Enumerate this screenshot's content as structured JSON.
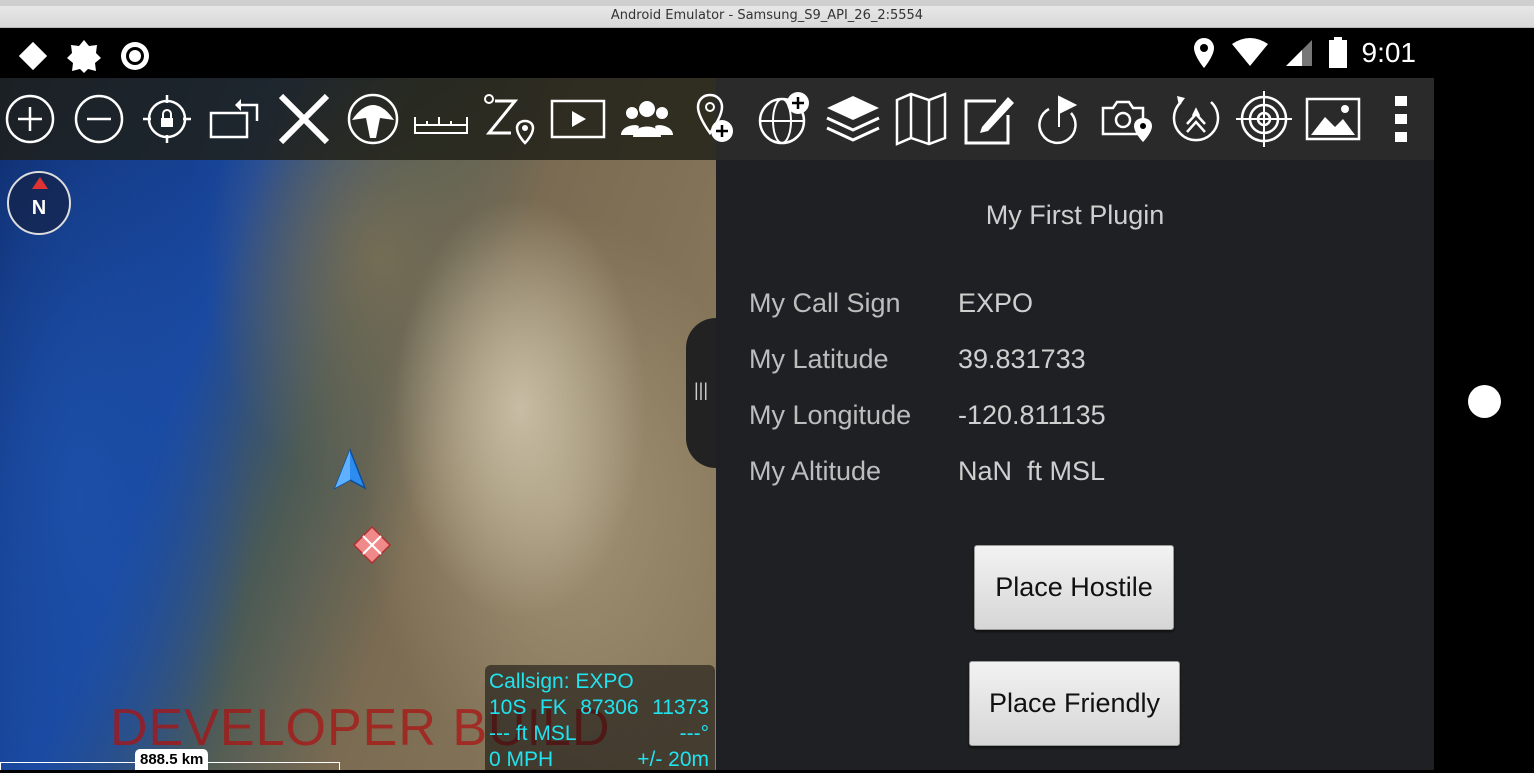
{
  "window": {
    "title": "Android Emulator - Samsung_S9_API_26_2:5554"
  },
  "status_bar": {
    "time": "9:01"
  },
  "toolbar": {
    "buttons": [
      "zoom-in",
      "zoom-out",
      "lock-location",
      "rotate",
      "close-tool",
      "nav-tool",
      "range-bearing",
      "goto",
      "video",
      "contacts",
      "add-point",
      "map-add",
      "overlay-manager",
      "map-manager",
      "drawing-tool",
      "route",
      "camera",
      "elevation",
      "target",
      "image-gallery",
      "overflow-menu"
    ]
  },
  "map": {
    "compass_label": "N",
    "watermark": "DEVELOPER BUILD",
    "scale_label": "888.5 km",
    "info": {
      "callsign": "Callsign: EXPO",
      "grid_zone": "10S",
      "grid_square": "FK",
      "easting": "87306",
      "northing": "11373",
      "altitude": "--- ft MSL",
      "heading": "---°",
      "speed": "0 MPH",
      "accuracy": "+/- 20m"
    }
  },
  "plugin": {
    "title": "My First Plugin",
    "fields": [
      {
        "label": "My Call Sign",
        "value": "EXPO"
      },
      {
        "label": "My Latitude",
        "value": "39.831733"
      },
      {
        "label": "My Longitude",
        "value": "-120.811135"
      },
      {
        "label": "My Altitude",
        "value": "NaN  ft MSL"
      }
    ],
    "buttons": {
      "hostile": "Place Hostile",
      "friendly": "Place Friendly"
    }
  }
}
